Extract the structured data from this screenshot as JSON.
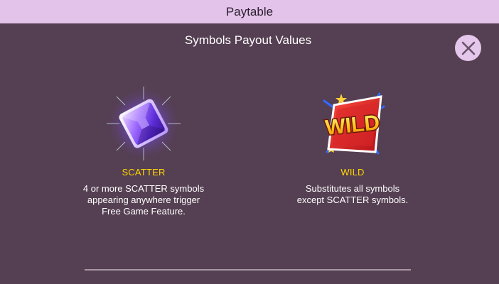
{
  "header": {
    "title": "Paytable"
  },
  "subtitle": "Symbols Payout Values",
  "close_button": {
    "icon": "close-icon"
  },
  "symbols": [
    {
      "name": "SCATTER",
      "description": "4 or more SCATTER symbols\nappearing anywhere trigger\nFree Game Feature.",
      "icon": "purple-gem-icon"
    },
    {
      "name": "WILD",
      "description": "Substitutes all symbols\nexcept SCATTER symbols.",
      "icon": "wild-badge-icon",
      "icon_text": "WILD"
    }
  ],
  "colors": {
    "header_bg": "#e4c3ea",
    "page_bg": "#553f52",
    "symbol_name": "#ffd800",
    "text": "#ffffff"
  }
}
